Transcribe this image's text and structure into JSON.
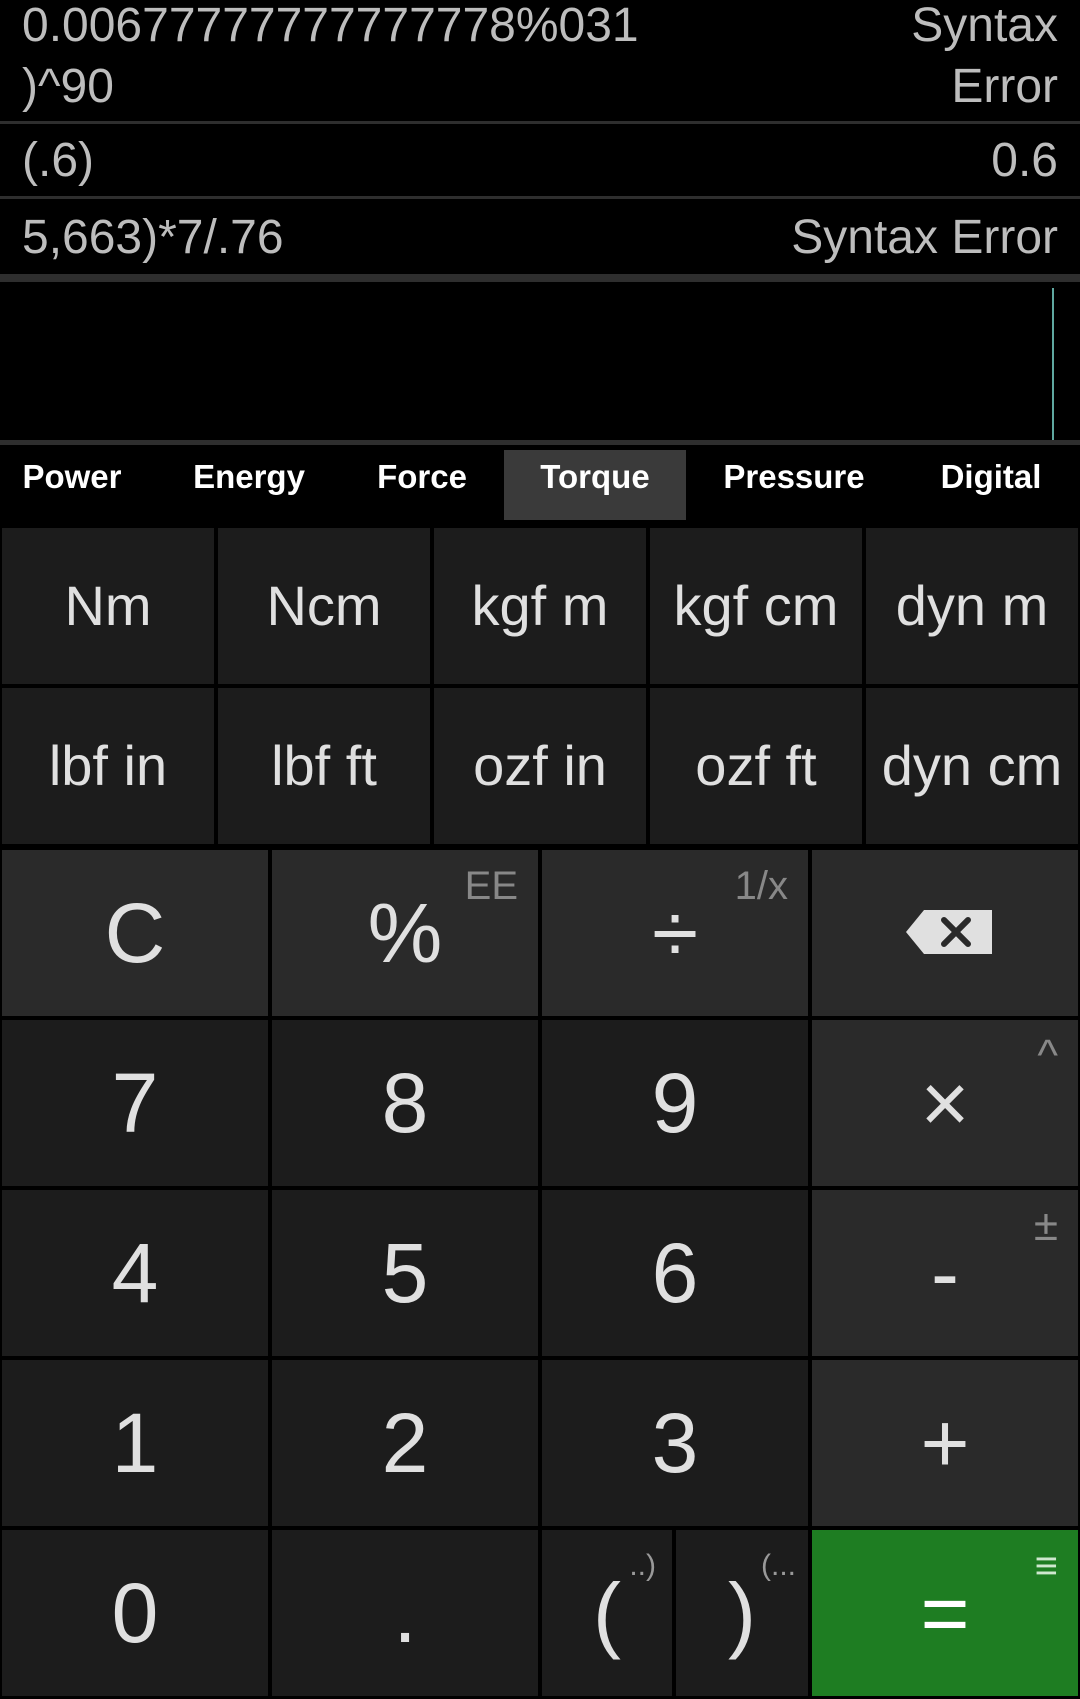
{
  "history": [
    {
      "expr_line1": "0.00677777777777778%031",
      "expr_line2": ")^90",
      "result_line1": "Syntax",
      "result_line2": "Error"
    },
    {
      "expr": "(.6)",
      "result": "0.6"
    },
    {
      "expr": "5,663)*7/.76",
      "result": "Syntax Error"
    }
  ],
  "tabs": [
    "Power",
    "Energy",
    "Force",
    "Torque",
    "Pressure",
    "Digital"
  ],
  "active_tab": "Torque",
  "units": {
    "row1": [
      "Nm",
      "Ncm",
      "kgf m",
      "kgf cm",
      "dyn m"
    ],
    "row2": [
      "lbf in",
      "lbf ft",
      "ozf in",
      "ozf ft",
      "dyn cm"
    ]
  },
  "keys": {
    "clear": "C",
    "percent": "%",
    "percent_sub": "EE",
    "divide": "÷",
    "divide_sub": "1/x",
    "seven": "7",
    "eight": "8",
    "nine": "9",
    "multiply": "×",
    "multiply_sub": "^",
    "four": "4",
    "five": "5",
    "six": "6",
    "minus": "-",
    "minus_sub": "±",
    "one": "1",
    "two": "2",
    "three": "3",
    "plus": "+",
    "zero": "0",
    "dot": ".",
    "open_paren": "(",
    "open_paren_sub": "..)",
    "close_paren": ")",
    "close_paren_sub": "(...",
    "equals": "=",
    "equals_sub": "≡"
  },
  "colors": {
    "equals_bg": "#1e7d22",
    "cursor": "#5fa8a0",
    "tab_active": "#3a3a3a"
  },
  "icons": {
    "backspace": "backspace-icon"
  }
}
